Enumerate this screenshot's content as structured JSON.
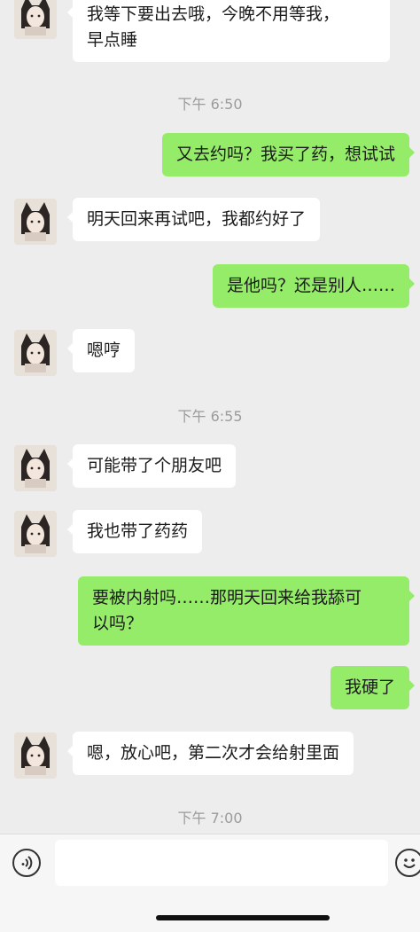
{
  "messages": [
    {
      "type": "in",
      "text_line1": "我等下要出去哦，今晚不用等我，",
      "text_line2": "早点睡"
    },
    {
      "type": "time",
      "text": "下午 6:50"
    },
    {
      "type": "out",
      "text": "又去约吗？我买了药，想试试"
    },
    {
      "type": "in",
      "text": "明天回来再试吧，我都约好了"
    },
    {
      "type": "out",
      "text": "是他吗？还是别人……"
    },
    {
      "type": "in",
      "text": "嗯哼"
    },
    {
      "type": "time",
      "text": "下午 6:55"
    },
    {
      "type": "in",
      "text": "可能带了个朋友吧"
    },
    {
      "type": "in",
      "text": "我也带了药药"
    },
    {
      "type": "out",
      "text_line1": "要被内射吗……那明天回来给我舔可",
      "text_line2": "以吗？"
    },
    {
      "type": "out",
      "text": "我硬了"
    },
    {
      "type": "in",
      "text": "嗯，放心吧，第二次才会给射里面"
    },
    {
      "type": "time",
      "text": "下午 7:00"
    }
  ],
  "input_bar": {
    "voice_icon": "voice-icon",
    "emoji_icon": "emoji-icon",
    "input_value": ""
  },
  "colors": {
    "background": "#ededed",
    "incoming_bubble": "#ffffff",
    "outgoing_bubble": "#95ec69",
    "timestamp": "#9b9b9b"
  }
}
